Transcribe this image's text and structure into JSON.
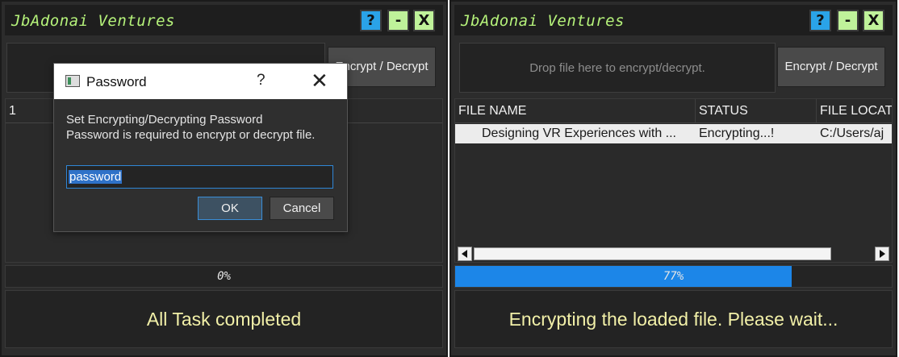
{
  "left": {
    "app_title": "JbAdonai Ventures",
    "window_buttons": {
      "help": "?",
      "minimize": "-",
      "close": "X"
    },
    "encrypt_button": "Encrypt / Decrypt",
    "table_first_cell": "1",
    "progress": {
      "label": "0%",
      "value": 0
    },
    "status_text": "All Task completed",
    "dialog": {
      "title": "Password",
      "help_glyph": "?",
      "close_glyph": "✕",
      "message_line1": "Set Encrypting/Decrypting Password",
      "message_line2": "Password is required to encrypt or decrypt file.",
      "input_value": "password",
      "ok_label": "OK",
      "cancel_label": "Cancel"
    }
  },
  "right": {
    "app_title": "JbAdonai Ventures",
    "window_buttons": {
      "help": "?",
      "minimize": "-",
      "close": "X"
    },
    "drop_placeholder": "Drop file here to encrypt/decrypt.",
    "encrypt_button": "Encrypt / Decrypt",
    "table": {
      "headers": [
        "FILE NAME",
        "STATUS",
        "FILE LOCAT"
      ],
      "rows": [
        {
          "file_name": "Designing VR Experiences with ...",
          "status": "Encrypting...!",
          "location": "C:/Users/aj"
        }
      ]
    },
    "progress": {
      "label": "77%",
      "value": 0.77
    },
    "status_text": "Encrypting the loaded file. Please wait..."
  },
  "colors": {
    "accent_blue": "#1c86e8",
    "title_green": "#b5f27a",
    "status_yellow": "#f2f0a8"
  }
}
